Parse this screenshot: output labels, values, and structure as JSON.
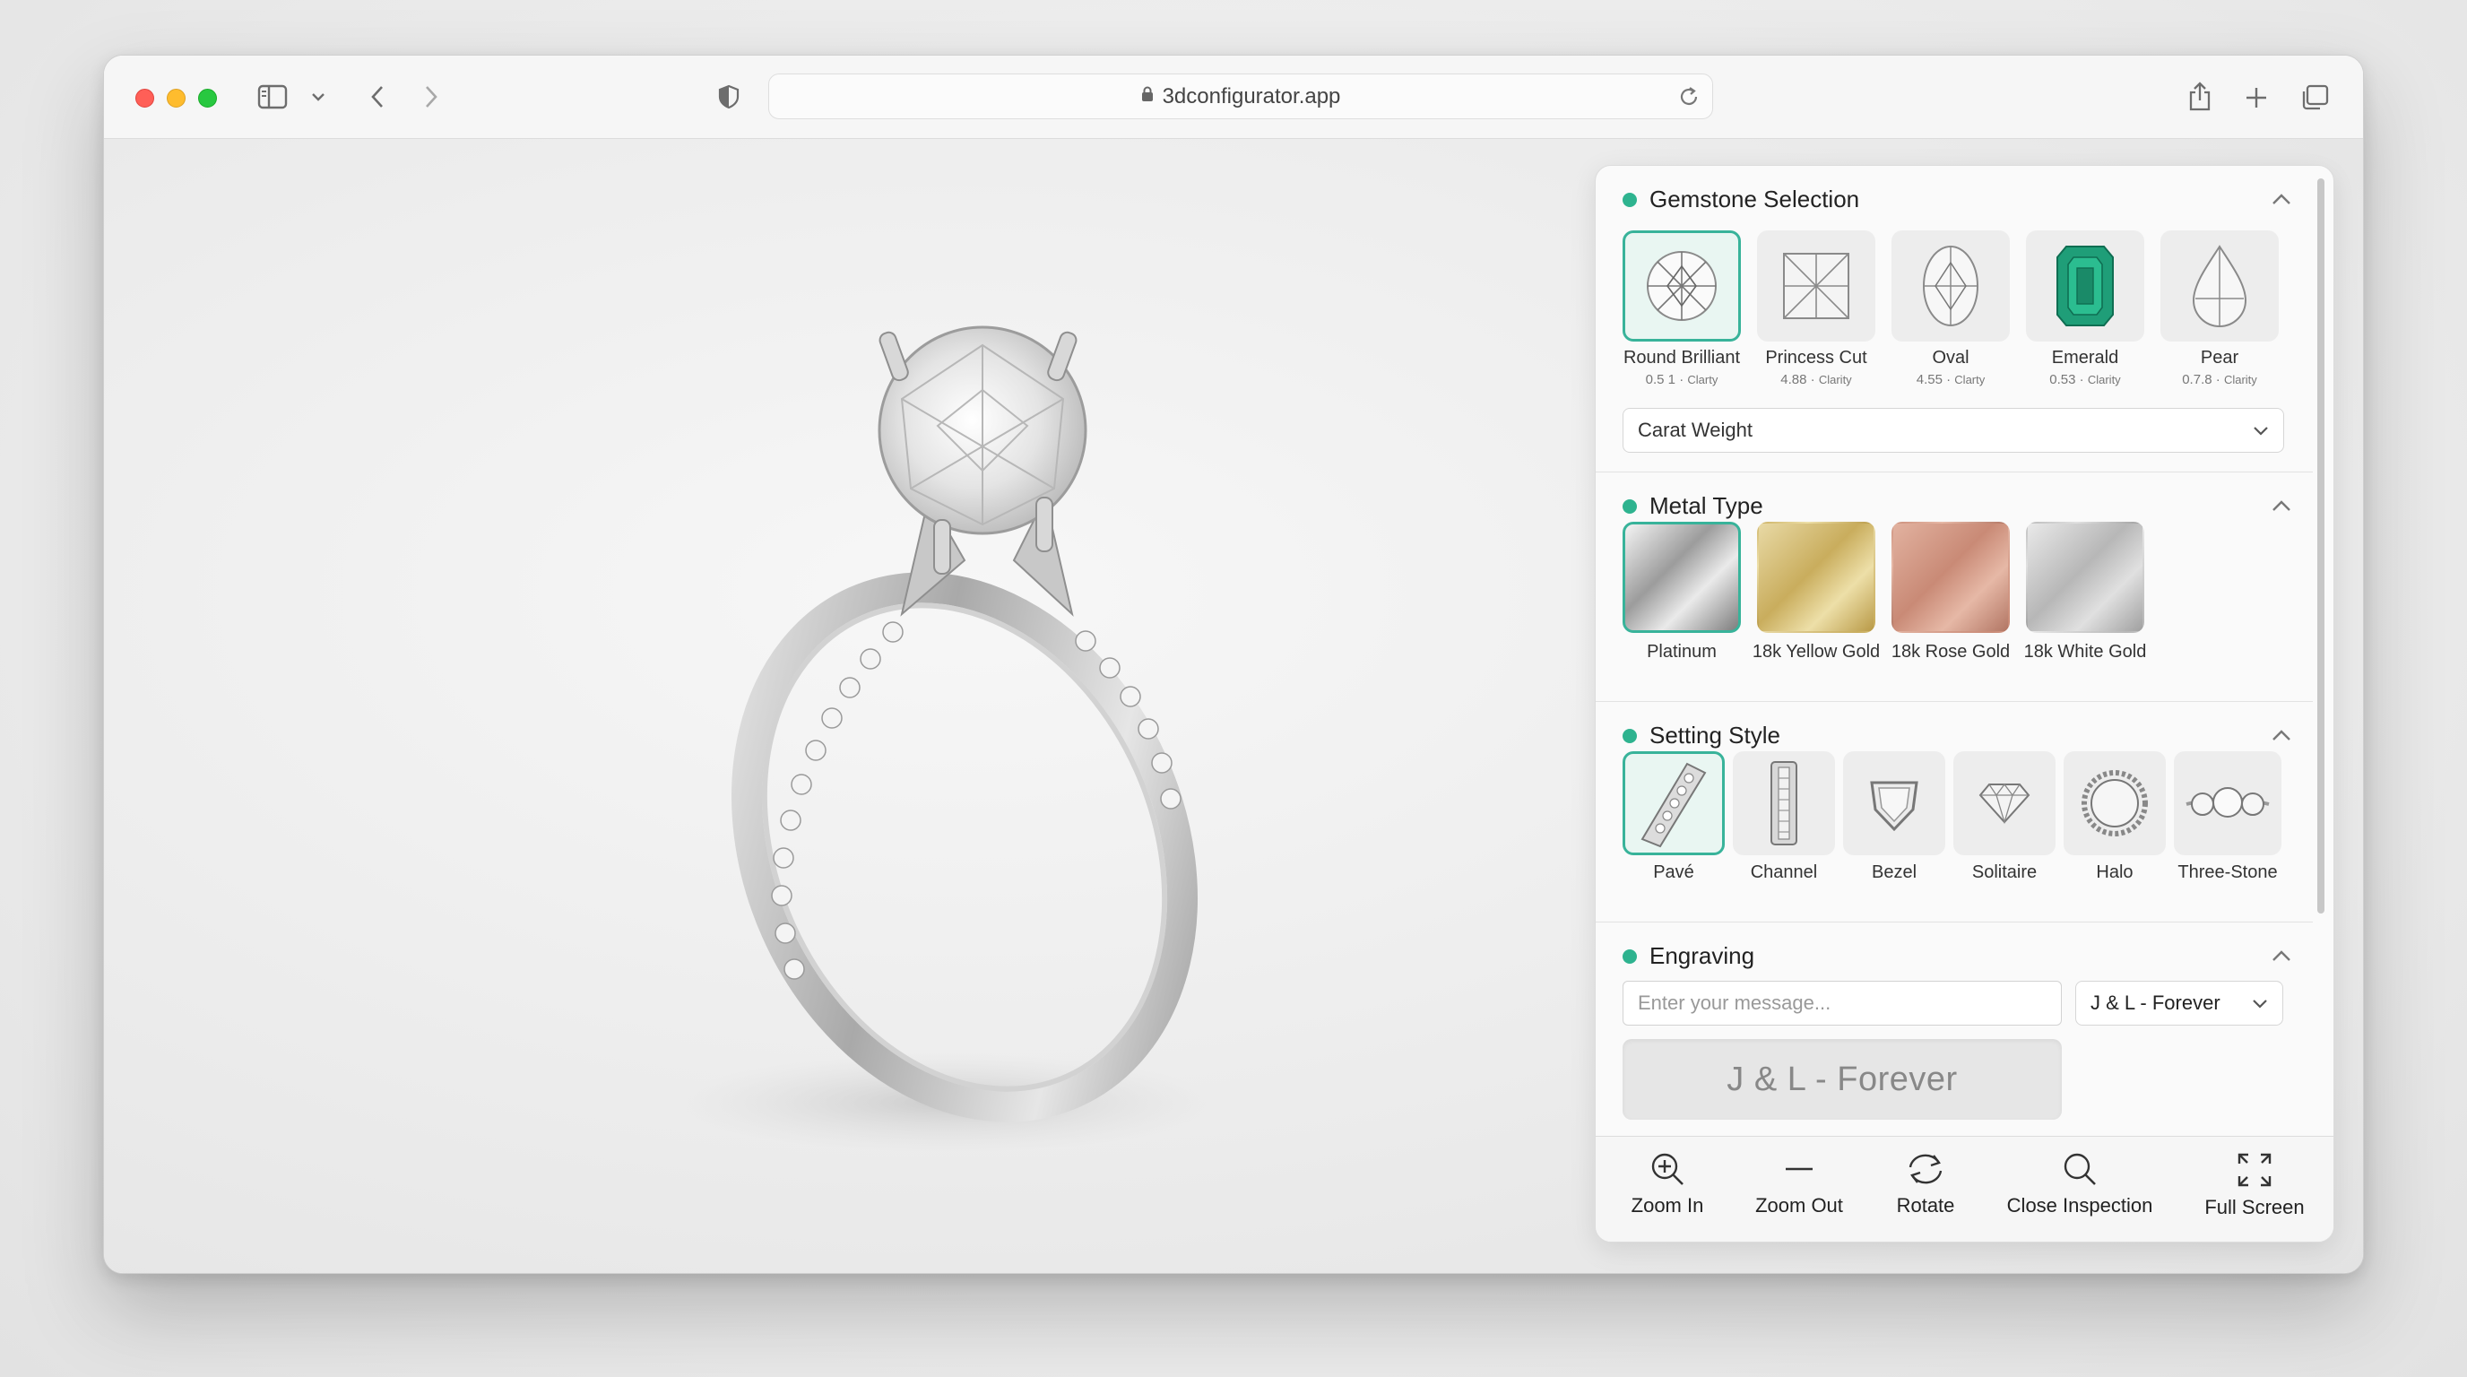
{
  "browser": {
    "url": "3dconfigurator.app"
  },
  "panel": {
    "gemstone": {
      "title": "Gemstone Selection",
      "options": [
        {
          "label": "Round Brilliant",
          "value": "0.5 1",
          "sub": "Clarty"
        },
        {
          "label": "Princess Cut",
          "value": "4.88",
          "sub": "Clarity"
        },
        {
          "label": "Oval",
          "value": "4.55",
          "sub": "Clarty"
        },
        {
          "label": "Emerald",
          "value": "0.53",
          "sub": "Clarity"
        },
        {
          "label": "Pear",
          "value": "0.7.8",
          "sub": "Clarity"
        }
      ],
      "selected": "Round Brilliant",
      "carat_select": "Carat Weight"
    },
    "metal": {
      "title": "Metal Type",
      "options": [
        {
          "label": "Platinum"
        },
        {
          "label": "18k Yellow Gold"
        },
        {
          "label": "18k Rose Gold"
        },
        {
          "label": "18k White Gold"
        }
      ],
      "selected": "Platinum"
    },
    "setting": {
      "title": "Setting Style",
      "options": [
        {
          "label": "Pavé"
        },
        {
          "label": "Channel"
        },
        {
          "label": "Bezel"
        },
        {
          "label": "Solitaire"
        },
        {
          "label": "Halo"
        },
        {
          "label": "Three-Stone"
        }
      ],
      "selected": "Pavé"
    },
    "engraving": {
      "title": "Engraving",
      "placeholder": "Enter your message...",
      "font_select": "J & L - Forever",
      "preview": "J & L - Forever"
    }
  },
  "bottom_bar": {
    "zoom_in": "Zoom In",
    "zoom_out": "Zoom Out",
    "rotate": "Rotate",
    "close_inspection": "Close Inspection",
    "full_screen": "Full Screen"
  },
  "colors": {
    "accent": "#38b39a",
    "dot": "#2eb38f"
  }
}
